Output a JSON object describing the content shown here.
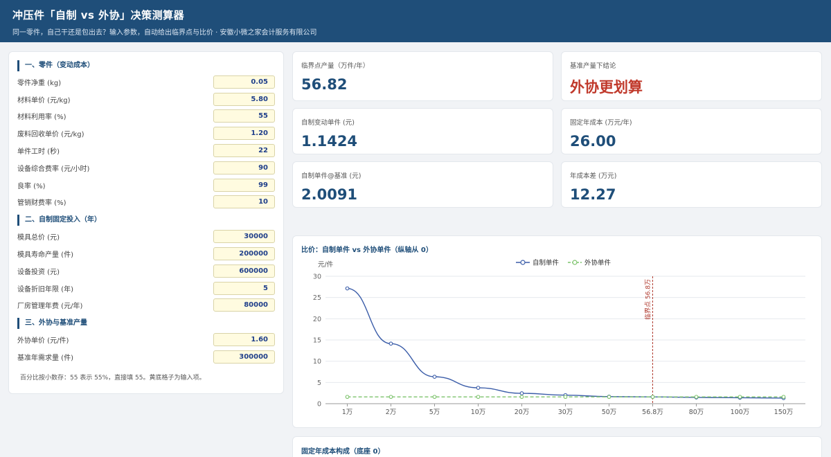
{
  "header": {
    "title": "冲压件「自制 vs 外协」决策测算器",
    "subtitle": "同一零件，自己干还是包出去？输入参数，自动给出临界点与比价 · 安徽小微之家会计服务有限公司"
  },
  "inputs": {
    "section1": "一、零件（变动成本）",
    "section2": "二、自制固定投入（年）",
    "section3": "三、外协与基准产量",
    "rows1": [
      {
        "label": "零件净重 (kg)",
        "value": "0.05"
      },
      {
        "label": "材料单价 (元/kg)",
        "value": "5.80"
      },
      {
        "label": "材料利用率 (%)",
        "value": "55"
      },
      {
        "label": "废料回收单价 (元/kg)",
        "value": "1.20"
      },
      {
        "label": "单件工时 (秒)",
        "value": "22"
      },
      {
        "label": "设备综合费率 (元/小时)",
        "value": "90"
      },
      {
        "label": "良率 (%)",
        "value": "99"
      },
      {
        "label": "管销财费率 (%)",
        "value": "10"
      }
    ],
    "rows2": [
      {
        "label": "模具总价 (元)",
        "value": "30000"
      },
      {
        "label": "模具寿命产量 (件)",
        "value": "200000"
      },
      {
        "label": "设备投资 (元)",
        "value": "600000"
      },
      {
        "label": "设备折旧年限 (年)",
        "value": "5"
      },
      {
        "label": "厂房管理年费 (元/年)",
        "value": "80000"
      }
    ],
    "rows3": [
      {
        "label": "外协单价 (元/件)",
        "value": "1.60"
      },
      {
        "label": "基准年需求量 (件)",
        "value": "300000"
      }
    ],
    "note": "百分比按小数存：55 表示 55%，直接填 55。黄底格子为输入项。"
  },
  "results": {
    "breakeven_label": "临界点产量（万件/年）",
    "breakeven_value": "56.82",
    "conclusion_label": "基准产量下结论",
    "conclusion_value": "外协更划算",
    "var_unit_label": "自制变动单件 (元)",
    "var_unit_value": "1.1424",
    "fixed_label": "固定年成本 (万元/年)",
    "fixed_value": "26.00",
    "unit_at_base_label": "自制单件@基准 (元)",
    "unit_at_base_value": "2.0091",
    "diff_label": "年成本差 (万元)",
    "diff_value": "12.27"
  },
  "colors": {
    "header_bg": "#1f4e79",
    "accent": "#1f4e79",
    "conclusion": "#c0392b",
    "input_bg": "#fffbe0",
    "series_self": "#3a5ca8",
    "series_outsource": "#7cc36b",
    "breakeven_line": "#b03a2e"
  },
  "chart_title": "比价：自制单件 vs 外协单件（纵轴从 0）",
  "bottom_title": "固定年成本构成（底座 0）",
  "chart_data": {
    "type": "line",
    "categories": [
      "1万",
      "2万",
      "5万",
      "10万",
      "20万",
      "30万",
      "50万",
      "56.8万",
      "80万",
      "100万",
      "150万"
    ],
    "series": [
      {
        "name": "自制单件",
        "values": [
          27.14,
          14.14,
          6.34,
          3.74,
          2.44,
          2.01,
          1.66,
          1.6,
          1.47,
          1.4,
          1.32
        ]
      },
      {
        "name": "外协单件",
        "values": [
          1.6,
          1.6,
          1.6,
          1.6,
          1.6,
          1.6,
          1.6,
          1.6,
          1.6,
          1.6,
          1.6
        ]
      }
    ],
    "ylabel": "元/件",
    "ylim": [
      0,
      30
    ],
    "yticks": [
      0,
      5,
      10,
      15,
      20,
      25,
      30
    ],
    "breakeven_label": "临界点 56.8万",
    "breakeven_category": "56.8万",
    "grid": true,
    "legend": "top-center"
  }
}
